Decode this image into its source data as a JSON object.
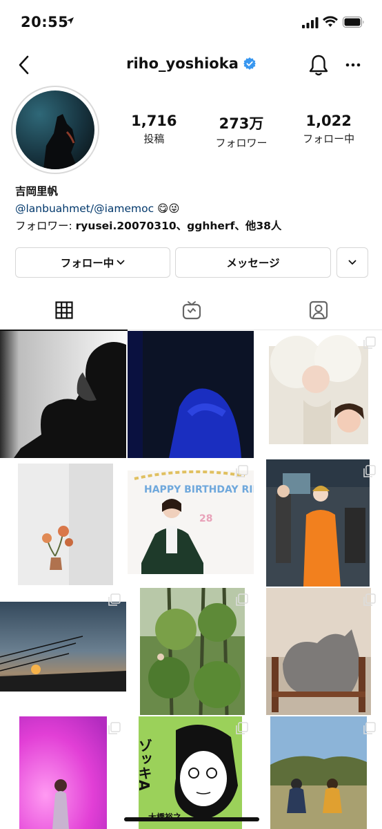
{
  "status": {
    "time": "20:55"
  },
  "nav": {
    "username": "riho_yoshioka"
  },
  "stats": [
    {
      "num": "1,716",
      "label": "投稿"
    },
    {
      "num": "273万",
      "label": "フォロワー"
    },
    {
      "num": "1,022",
      "label": "フォロー中"
    }
  ],
  "bio": {
    "name": "吉岡里帆",
    "link1": "@lanbuahmet",
    "sep": "/",
    "link2": "@iamemoc",
    "emoji": "😋😜",
    "followed_prefix": "フォロワー: ",
    "followed_names": "ryusei.20070310、gghherf、他38人"
  },
  "actions": {
    "follow": "フォロー中",
    "message": "メッセージ"
  },
  "grid_text": {
    "birthday": "HAPPY BIRTHDAY RIHO",
    "birthday_num": "28",
    "book_title": "ゾッキA",
    "book_author": "大橋裕之"
  },
  "colors": {
    "verified": "#3897f0",
    "link": "#00376b"
  }
}
